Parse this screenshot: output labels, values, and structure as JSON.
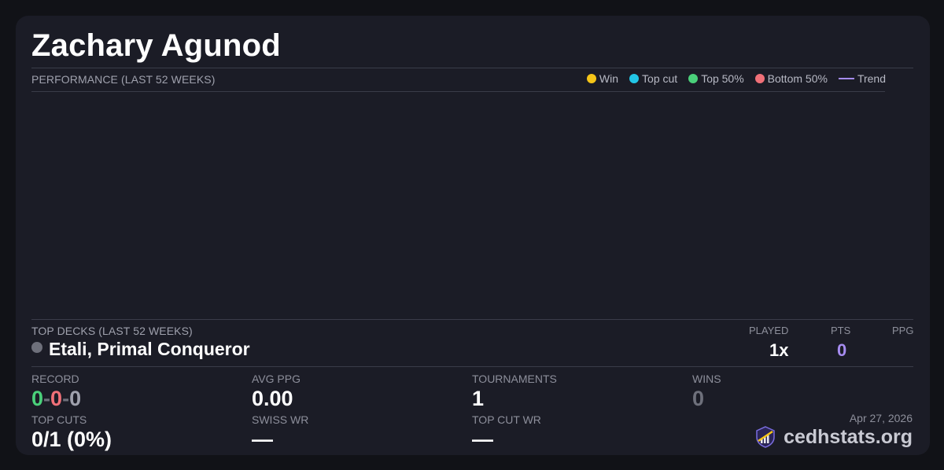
{
  "player": {
    "name": "Zachary Agunod"
  },
  "performance": {
    "title": "PERFORMANCE (LAST 52 WEEKS)",
    "legend": [
      {
        "label": "Win",
        "color": "#f5c518",
        "kind": "dot"
      },
      {
        "label": "Top cut",
        "color": "#22c6e6",
        "kind": "dot"
      },
      {
        "label": "Top 50%",
        "color": "#4ad07a",
        "kind": "dot"
      },
      {
        "label": "Bottom 50%",
        "color": "#f07078",
        "kind": "dot"
      },
      {
        "label": "Trend",
        "color": "#a68cf0",
        "kind": "line"
      }
    ]
  },
  "top_decks": {
    "title": "TOP DECKS (LAST 52 WEEKS)",
    "columns": {
      "played": "PLAYED",
      "pts": "PTS",
      "ppg": "PPG"
    },
    "deck": {
      "name": "Etali, Primal Conqueror",
      "played": "1x",
      "pts": "0",
      "ppg": ""
    }
  },
  "stats": {
    "record": {
      "label": "RECORD",
      "wins": "0",
      "losses": "0",
      "draws": "0",
      "sep": "-"
    },
    "avg_ppg": {
      "label": "AVG PPG",
      "value": "0.00"
    },
    "tournaments": {
      "label": "TOURNAMENTS",
      "value": "1"
    },
    "wins": {
      "label": "WINS",
      "value": "0"
    },
    "top_cuts": {
      "label": "TOP CUTS",
      "value": "0/1 (0%)"
    },
    "swiss_wr": {
      "label": "SWISS WR",
      "value": "—"
    },
    "top_cut_wr": {
      "label": "TOP CUT WR",
      "value": "—"
    }
  },
  "footer": {
    "date": "Apr 27, 2026",
    "brand": "cedhstats.org",
    "logo_icon": "chart-logo-icon"
  },
  "colors": {
    "win_green": "#4ad07a",
    "loss_red": "#f07078",
    "draw_gray": "#9fa1ad",
    "pts_purple": "#a68cf0",
    "muted": "#6e707b"
  }
}
